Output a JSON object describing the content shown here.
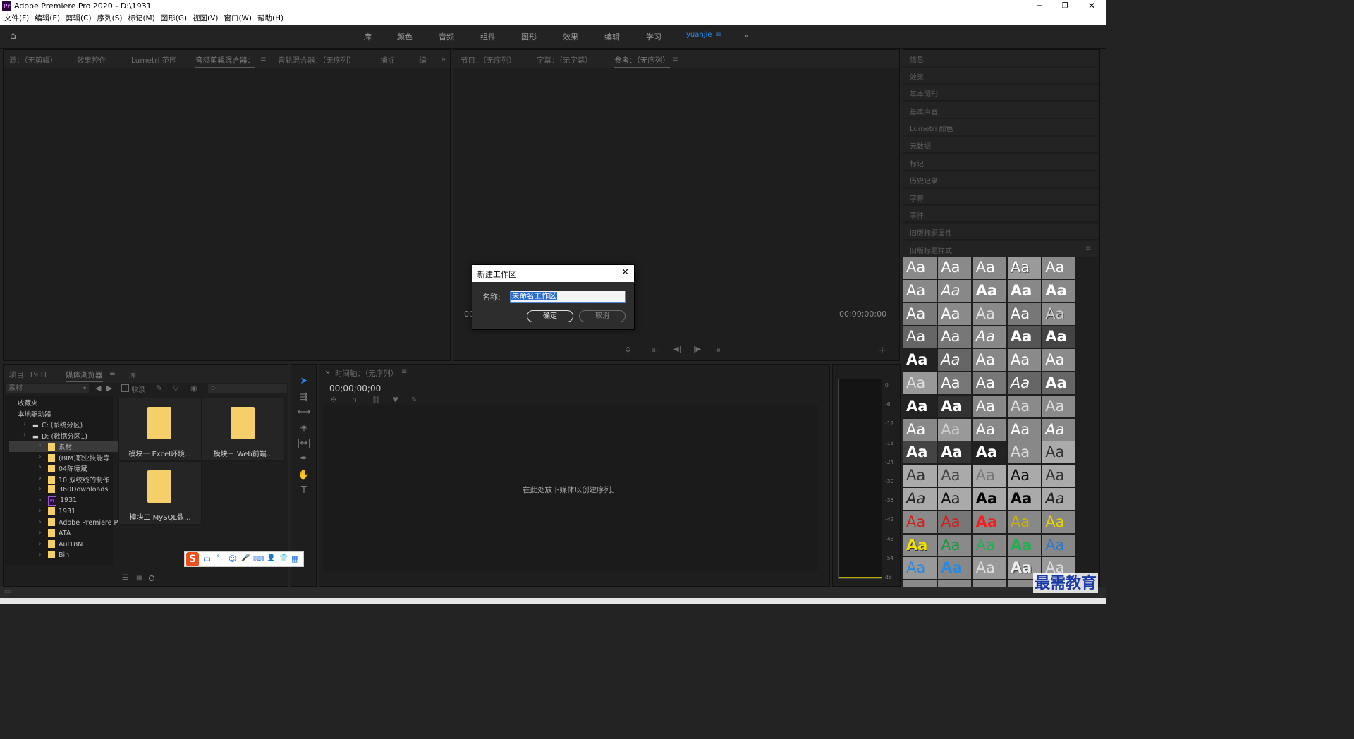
{
  "titlebar": {
    "title": "Adobe Premiere Pro 2020 - D:\\1931",
    "logo": "Pr",
    "minimize": "─",
    "maximize": "❐",
    "close": "✕"
  },
  "menu": [
    "文件(F)",
    "编辑(E)",
    "剪辑(C)",
    "序列(S)",
    "标记(M)",
    "图形(G)",
    "视图(V)",
    "窗口(W)",
    "帮助(H)"
  ],
  "workspaces": {
    "home_icon": "home-icon",
    "tabs": [
      "库",
      "颜色",
      "音频",
      "组件",
      "图形",
      "效果",
      "编辑",
      "学习",
      "yuanjie"
    ],
    "active": "yuanjie",
    "more": "»"
  },
  "source_panel": {
    "tabs": [
      "源：（无剪辑）",
      "效果控件",
      "Lumetri 范围",
      "音频剪辑混合器：",
      "音轨混合器：（无序列）",
      "捕捉",
      "编"
    ],
    "selected": "音频剪辑混合器：",
    "more": "»"
  },
  "program_panel": {
    "tabs": [
      "节目：（无序列）",
      "字幕：（无字幕）",
      "参考：（无序列）"
    ],
    "selected": "参考：（无序列）",
    "timecode_left": "00",
    "timecode_right": "00;00;00;00"
  },
  "right_panels": [
    "信息",
    "效果",
    "基本图形",
    "基本声音",
    "Lumetri 颜色",
    "元数据",
    "标记",
    "历史记录",
    "字幕",
    "事件",
    "旧版标题属性",
    "旧版标题样式"
  ],
  "swatch_label": "Aa",
  "project_panel": {
    "tabs": [
      "项目: 1931",
      "媒体浏览器",
      "库"
    ],
    "selected": "媒体浏览器",
    "path_dropdown": "素材",
    "ingest_label": "收录",
    "search_placeholder": "ρ-",
    "tree": [
      {
        "label": "收藏夹",
        "indent": 0,
        "type": "head"
      },
      {
        "label": "本地驱动器",
        "indent": 0,
        "type": "head"
      },
      {
        "label": "C: (系统分区)",
        "indent": 1,
        "type": "drive"
      },
      {
        "label": "D: (数据分区1)",
        "indent": 1,
        "type": "drive"
      },
      {
        "label": "素材",
        "indent": 2,
        "type": "folder",
        "selected": true
      },
      {
        "label": "(BIM)职业技能等",
        "indent": 2,
        "type": "folder"
      },
      {
        "label": "04陈德斌",
        "indent": 2,
        "type": "folder"
      },
      {
        "label": "10 双绞线的制作",
        "indent": 2,
        "type": "folder"
      },
      {
        "label": "360Downloads",
        "indent": 2,
        "type": "folder"
      },
      {
        "label": "1931",
        "indent": 2,
        "type": "pr"
      },
      {
        "label": "1931",
        "indent": 2,
        "type": "folder"
      },
      {
        "label": "Adobe Premiere Pr",
        "indent": 2,
        "type": "folder"
      },
      {
        "label": "ATA",
        "indent": 2,
        "type": "folder"
      },
      {
        "label": "Aul18N",
        "indent": 2,
        "type": "folder"
      },
      {
        "label": "Bin",
        "indent": 2,
        "type": "folder"
      }
    ],
    "grid": [
      "模块一 Excel环境...",
      "模块三 Web前端...",
      "模块二 MySQL数..."
    ]
  },
  "timeline": {
    "tab": "时间轴：（无序列）",
    "timecode": "00;00;00;00",
    "empty_msg": "在此处放下媒体以创建序列。"
  },
  "meter": {
    "labels": [
      "0",
      "-6",
      "-12",
      "-18",
      "-24",
      "-30",
      "-36",
      "-42",
      "-48",
      "-54",
      "dB"
    ]
  },
  "dialog": {
    "title": "新建工作区",
    "name_label": "名称:",
    "name_value": "未命名工作区",
    "ok": "确定",
    "cancel": "取消",
    "close": "✕"
  },
  "ime": {
    "logo": "S",
    "items": [
      "中",
      "°,",
      "☺",
      "🎤",
      "⌨",
      "👤",
      "👕",
      "▦"
    ]
  },
  "watermark": "最需教育",
  "colors": {
    "accent": "#2d8ceb",
    "bg": "#232323",
    "panel": "#1e1e1e",
    "folder": "#f5cf6a"
  }
}
